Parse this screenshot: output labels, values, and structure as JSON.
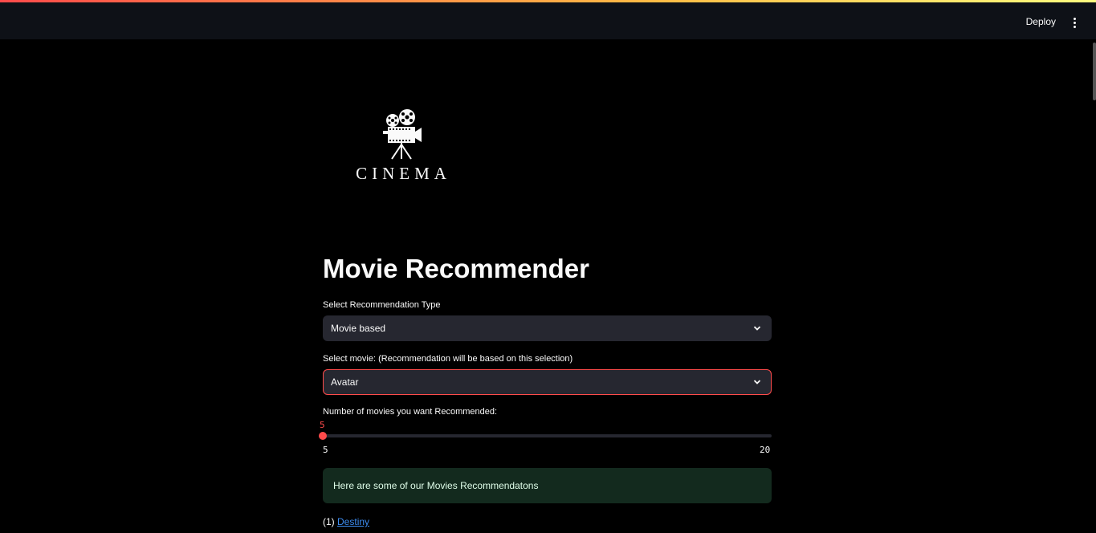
{
  "header": {
    "deploy_label": "Deploy",
    "menu_icon": "kebab-menu-icon"
  },
  "logo": {
    "icon": "movie-camera-icon",
    "text": "CINEMA"
  },
  "page": {
    "title": "Movie Recommender"
  },
  "recommendation_type": {
    "label": "Select Recommendation Type",
    "value": "Movie based"
  },
  "movie_select": {
    "label": "Select movie: (Recommendation will be based on this selection)",
    "value": "Avatar"
  },
  "count_slider": {
    "label": "Number of movies you want Recommended:",
    "current": "5",
    "min": "5",
    "max": "20",
    "fraction": 0
  },
  "results": {
    "message": "Here are some of our Movies Recommendatons",
    "items": [
      {
        "index": "(1)",
        "title": "Destiny"
      }
    ]
  },
  "colors": {
    "accent": "#ff4b4b",
    "success_bg": "#132a1e",
    "link": "#3d8cf0"
  }
}
